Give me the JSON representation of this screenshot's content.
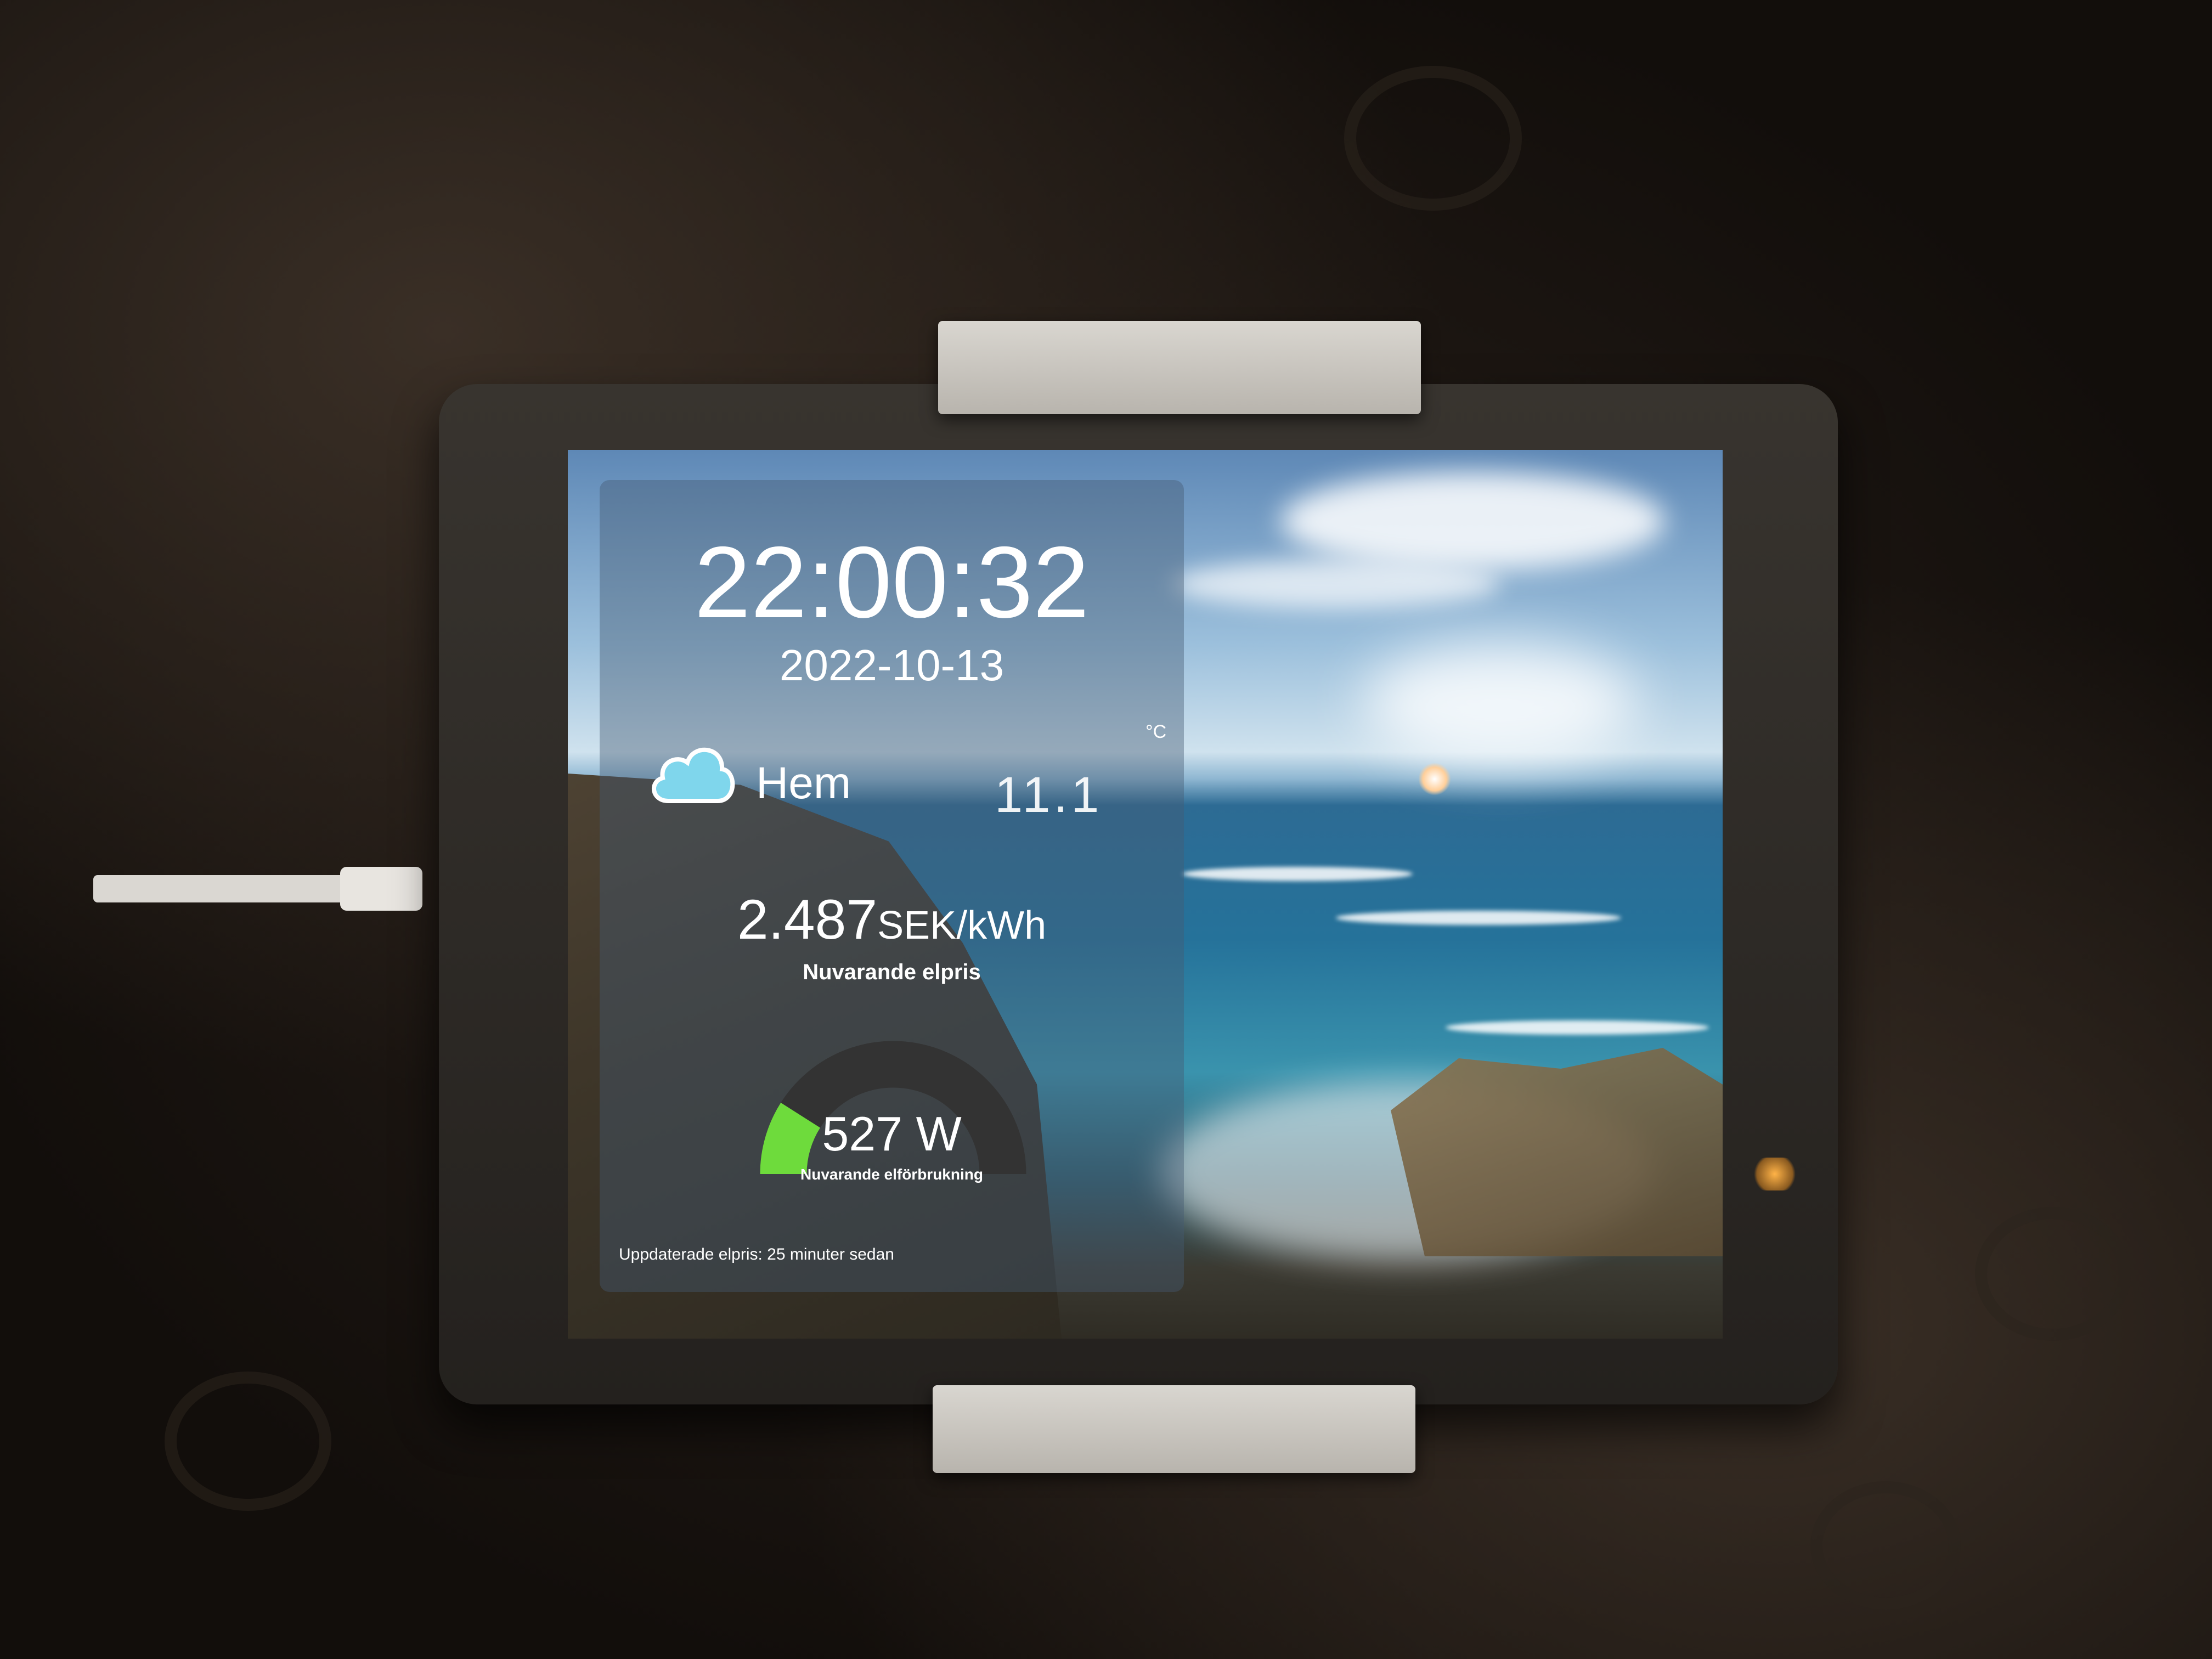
{
  "clock": {
    "time": "22:00:32",
    "date": "2022-10-13"
  },
  "weather": {
    "icon": "cloud-icon",
    "location": "Hem",
    "temperature": "11.1",
    "unit": "°C"
  },
  "electricity": {
    "price_value": "2.487",
    "price_unit": "SEK/kWh",
    "price_label": "Nuvarande elpris",
    "power_value": "527 W",
    "power_label": "Nuvarande elförbrukning",
    "power_gauge_fraction": 0.18,
    "gauge_color": "#6edb3c",
    "gauge_track_color": "#333333"
  },
  "status": {
    "updated_text": "Uppdaterade elpris: 25 minuter sedan"
  }
}
